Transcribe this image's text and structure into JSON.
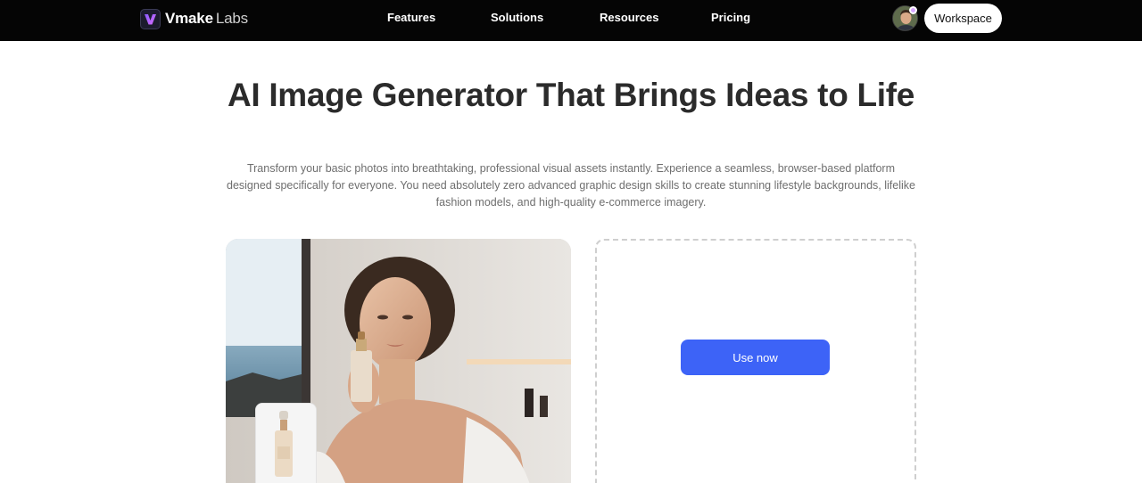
{
  "navbar": {
    "logo_brand": "Vmake",
    "logo_sub": "Labs",
    "links": [
      "Features",
      "Solutions",
      "Resources",
      "Pricing"
    ],
    "workspace_label": "Workspace"
  },
  "hero": {
    "title": "AI Image Generator That Brings Ideas to Life",
    "description": "Transform your basic photos into breathtaking, professional visual assets instantly. Experience a seamless, browser-based platform designed specifically for everyone. You need absolutely zero advanced graphic design skills to create stunning lifestyle backgrounds, lifelike fashion models, and high-quality e-commerce imagery."
  },
  "upload": {
    "button_label": "Use now"
  },
  "colors": {
    "accent": "#3d63f7",
    "navbar_bg": "#050505",
    "logo_gradient_start": "#8a5cff",
    "logo_gradient_end": "#d66bff"
  },
  "icons": {
    "logo": "vmake-logo-icon",
    "avatar": "user-avatar",
    "thumbnail": "serum-bottle-icon"
  }
}
